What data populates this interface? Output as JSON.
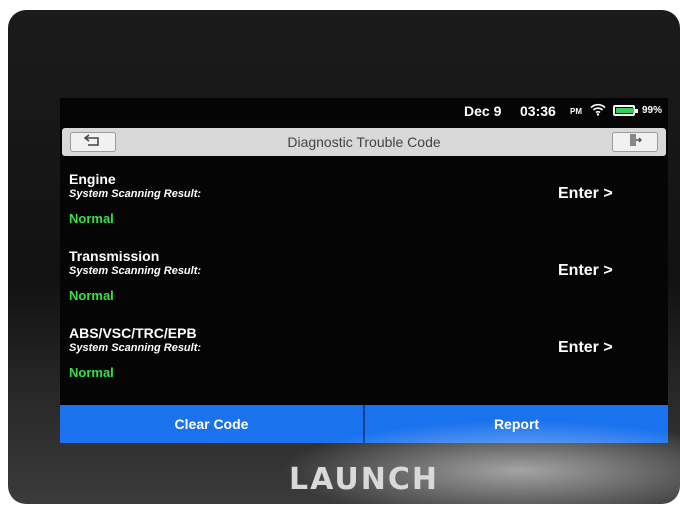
{
  "status_bar": {
    "date": "Dec 9",
    "time": "03:36",
    "ampm": "PM",
    "wifi_icon": "wifi-icon",
    "battery_level": 0.99,
    "battery_percent": "99%"
  },
  "header": {
    "title": "Diagnostic Trouble Code",
    "back_icon": "back-arrow-icon",
    "exit_icon": "exit-icon"
  },
  "systems": [
    {
      "name": "Engine",
      "result_label": "System Scanning Result:",
      "status": "Normal",
      "enter_label": "Enter >"
    },
    {
      "name": "Transmission",
      "result_label": "System Scanning Result:",
      "status": "Normal",
      "enter_label": "Enter >"
    },
    {
      "name": "ABS/VSC/TRC/EPB",
      "result_label": "System Scanning Result:",
      "status": "Normal",
      "enter_label": "Enter >"
    }
  ],
  "footer": {
    "clear_code_label": "Clear Code",
    "report_label": "Report"
  },
  "brand": "LAUNCH",
  "colors": {
    "accent_blue": "#1a72ee",
    "normal_green": "#35e04a",
    "screen_bg": "#050505"
  }
}
